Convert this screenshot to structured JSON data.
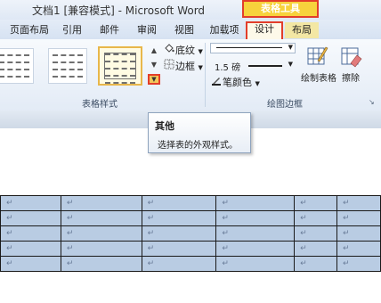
{
  "window": {
    "title": "文档1 [兼容模式] - Microsoft Word"
  },
  "contextual_tab": {
    "label": "表格工具"
  },
  "tabs": [
    "页面布局",
    "引用",
    "邮件",
    "审阅",
    "视图",
    "加载项",
    "设计",
    "布局"
  ],
  "ribbon": {
    "table_styles_group": {
      "label": "表格样式",
      "shading_label": "底纹",
      "borders_label": "边框"
    },
    "draw_borders_group": {
      "label": "绘图边框",
      "line_weight": "1.5 磅",
      "pen_color_label": "笔颜色",
      "draw_table_label": "绘制表格",
      "eraser_label": "擦除"
    }
  },
  "tooltip": {
    "title": "其他",
    "description": "选择表的外观样式。"
  },
  "table": {
    "cell_mark": "↵",
    "rows": [
      [
        "↵",
        "↵",
        "↵",
        "↵",
        "↵",
        "↵"
      ],
      [
        "↵",
        "↵",
        "↵",
        "↵",
        "↵",
        "↵"
      ],
      [
        "↵",
        "↵",
        "↵",
        "↵",
        "↵",
        "↵"
      ],
      [
        "↵",
        "↵",
        "↵",
        "↵",
        "↵",
        "↵"
      ],
      [
        "↵",
        "↵",
        "↵",
        "↵",
        "↵",
        "↵"
      ]
    ]
  },
  "colors": {
    "highlight_border": "#e23d2a",
    "contextual_tab_fill": "#f7d23c",
    "table_cell_fill": "#b9cce3"
  }
}
